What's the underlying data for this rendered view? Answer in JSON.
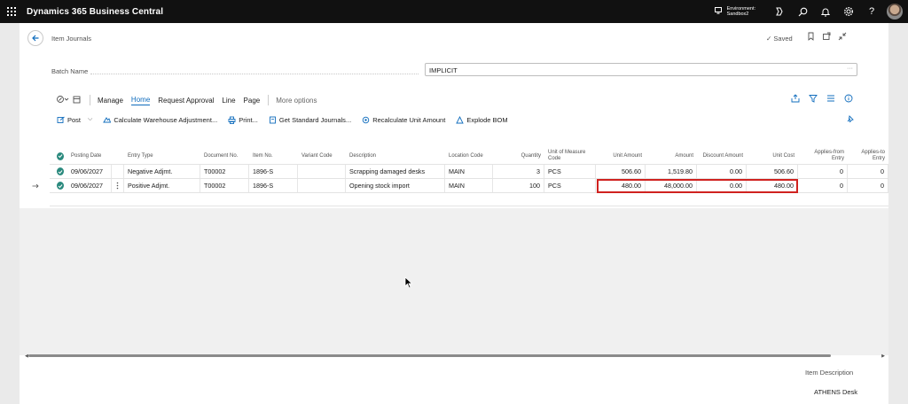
{
  "app": {
    "title": "Dynamics 365 Business Central"
  },
  "topbar": {
    "environment_line1": "Environment:",
    "environment_line2": "Sandbox2",
    "icons": [
      "waffle-icon",
      "environment-icon",
      "copilot-icon",
      "search-icon",
      "bell-icon",
      "gear-icon",
      "help-icon",
      "avatar"
    ]
  },
  "page": {
    "title": "Item Journals",
    "saved_label": "Saved",
    "batch_label": "Batch Name",
    "batch_value": "IMPLICIT"
  },
  "actions": {
    "manage": "Manage",
    "home": "Home",
    "request_approval": "Request Approval",
    "line": "Line",
    "page": "Page",
    "more": "More options"
  },
  "subactions": {
    "post": "Post",
    "calc_warehouse": "Calculate Warehouse Adjustment...",
    "print": "Print...",
    "get_standard": "Get Standard Journals...",
    "recalc_unit": "Recalculate Unit Amount",
    "explode_bom": "Explode BOM"
  },
  "table": {
    "columns": {
      "posting_date": "Posting Date",
      "entry_type": "Entry Type",
      "document_no": "Document No.",
      "item_no": "Item No.",
      "variant_code": "Variant Code",
      "description": "Description",
      "location_code": "Location Code",
      "quantity": "Quantity",
      "uom": "Unit of Measure Code",
      "unit_amount": "Unit Amount",
      "amount": "Amount",
      "discount_amount": "Discount Amount",
      "unit_cost": "Unit Cost",
      "applies_from": "Applies-from Entry",
      "applies_to": "Applies-to Entry"
    },
    "rows": [
      {
        "posting_date": "09/06/2027",
        "entry_type": "Negative Adjmt.",
        "document_no": "T00002",
        "item_no": "1896-S",
        "variant_code": "",
        "description": "Scrapping damaged desks",
        "location_code": "MAIN",
        "quantity": "3",
        "uom": "PCS",
        "unit_amount": "506.60",
        "amount": "1,519.80",
        "discount_amount": "0.00",
        "unit_cost": "506.60",
        "applies_from": "0",
        "applies_to": "0"
      },
      {
        "posting_date": "09/06/2027",
        "entry_type": "Positive Adjmt.",
        "document_no": "T00002",
        "item_no": "1896-S",
        "variant_code": "",
        "description": "Opening stock import",
        "location_code": "MAIN",
        "quantity": "100",
        "uom": "PCS",
        "unit_amount": "480.00",
        "amount": "48,000.00",
        "discount_amount": "0.00",
        "unit_cost": "480.00",
        "applies_from": "0",
        "applies_to": "0"
      }
    ]
  },
  "factbox": {
    "item_description_label": "Item Description",
    "item_description_value": "ATHENS Desk"
  },
  "colors": {
    "accent": "#0f6cbd",
    "highlight": "#d0221f",
    "status_ok": "#2b8a7e"
  }
}
